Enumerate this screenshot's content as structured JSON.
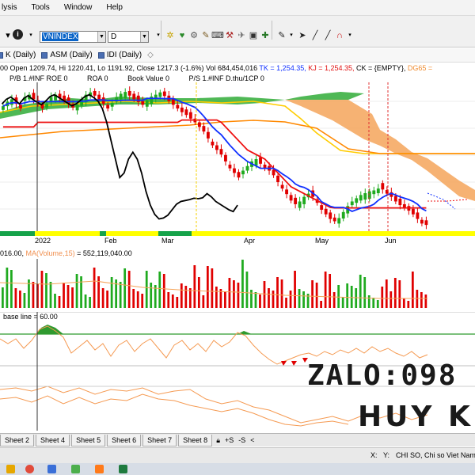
{
  "menu": {
    "items": [
      "lysis",
      "Tools",
      "Window",
      "Help"
    ]
  },
  "toolbar": {
    "symbol_value": "VNINDEX",
    "period_value": "D",
    "icons": [
      "dropdown-arrow-icon",
      "info-icon",
      "chart-tool-icons",
      "color-picker-icon",
      "line-draw-icon",
      "magnet-icon"
    ]
  },
  "chart_tabs": [
    {
      "label": "K (Daily)"
    },
    {
      "label": "ASM (Daily)"
    },
    {
      "label": "IDI (Daily)"
    }
  ],
  "quote": {
    "prefix": "00 Open 1209.74, Hi 1220.41, Lo 1191.92, Close 1217.3 (-1.6%) Vol 684,454,016",
    "tk": "TK = 1,254.35,",
    "kj": "KJ = 1,254.35,",
    "ck": "CK = {EMPTY},",
    "dg": "DG65 ="
  },
  "ratios": [
    "P/B 1.#INF ROE 0",
    "ROA 0",
    "Book Value 0",
    "P/S 1.#INF D.thu/1CP 0"
  ],
  "months": [
    "2022",
    "Feb",
    "Mar",
    "Apr",
    "May",
    "Jun"
  ],
  "volume_legend": {
    "prefix": "016.00,",
    "ma": "MA(Volume,15)",
    "suffix": "= 552,119,040.00"
  },
  "indicator_legend": "base line = 60.00",
  "watermark": {
    "line1": "ZALO:098",
    "line2": "HUY KI"
  },
  "sheets": [
    "Sheet 2",
    "Sheet 4",
    "Sheet 5",
    "Sheet 6",
    "Sheet 7",
    "Sheet 8"
  ],
  "sheet_controls": [
    "+S",
    "-S"
  ],
  "status": {
    "x": "X:",
    "y": "Y:",
    "title": "CHI SO, Chi so Viet Nam"
  },
  "colors": {
    "candle_up": "#1faa1f",
    "candle_down": "#e00000",
    "tenkan": "#1030ff",
    "kijun": "#ee1010",
    "cloud_orange": "#f5a45a",
    "cloud_green": "#3cb043",
    "lagging": "#000000",
    "senkou_a": "#ffcc00",
    "senkou_b": "#ff8800",
    "base_line": "#2f9a2f",
    "oscillator": "#f59a52"
  },
  "chart_data": {
    "type": "line",
    "price_pane": {
      "close": [
        1475,
        1485,
        1490,
        1480,
        1470,
        1495,
        1500,
        1490,
        1480,
        1470,
        1480,
        1495,
        1500,
        1492,
        1486,
        1480,
        1472,
        1478,
        1490,
        1500,
        1505,
        1498,
        1488,
        1480,
        1470,
        1482,
        1495,
        1502,
        1506,
        1498,
        1490,
        1484,
        1478,
        1488,
        1496,
        1500,
        1505,
        1497,
        1486,
        1478,
        1470,
        1462,
        1456,
        1448,
        1440,
        1430,
        1420,
        1405,
        1390,
        1380,
        1370,
        1355,
        1340,
        1330,
        1320,
        1335,
        1345,
        1355,
        1360,
        1350,
        1340,
        1335,
        1325,
        1310,
        1296,
        1284,
        1270,
        1262,
        1268,
        1278,
        1285,
        1278,
        1265,
        1250,
        1240,
        1230,
        1225,
        1232,
        1245,
        1258,
        1268,
        1275,
        1282,
        1286,
        1290,
        1292,
        1296,
        1294,
        1285,
        1278,
        1268,
        1260,
        1254,
        1248,
        1240,
        1230,
        1220,
        1217
      ],
      "kijun": [
        1430,
        1430,
        1430,
        1430,
        1430,
        1430,
        1430,
        1430,
        1440,
        1440,
        1440,
        1440,
        1440,
        1440,
        1440,
        1440,
        1440,
        1440,
        1440,
        1440,
        1440,
        1440,
        1440,
        1440,
        1440,
        1440,
        1440,
        1440,
        1440,
        1440,
        1440,
        1440,
        1440,
        1440,
        1440,
        1440,
        1440,
        1440,
        1440,
        1440,
        1440,
        1445,
        1445,
        1445,
        1445,
        1445,
        1445,
        1445,
        1445,
        1445,
        1440,
        1430,
        1420,
        1410,
        1400,
        1390,
        1380,
        1375,
        1370,
        1365,
        1360,
        1350,
        1340,
        1330,
        1320,
        1310,
        1300,
        1295,
        1290,
        1285,
        1280,
        1275,
        1270,
        1265,
        1260,
        1255,
        1254,
        1254,
        1254,
        1254,
        1254,
        1254,
        1254,
        1254,
        1254,
        1254,
        1254,
        1254,
        1254,
        1254,
        1254,
        1254,
        1254,
        1254,
        1254,
        1254,
        1254,
        1254
      ],
      "lagging": [
        1480,
        1490,
        1495,
        1488,
        1480,
        1492,
        1498,
        1490,
        1484,
        1478,
        1486,
        1496,
        1500,
        1494,
        1488,
        1482,
        1476,
        1480,
        1488,
        1496,
        1500,
        1494,
        1486,
        1470,
        1440,
        1400,
        1360,
        1320,
        1330,
        1360,
        1375,
        1360,
        1330,
        1290,
        1260,
        1240,
        1230,
        1232,
        1238,
        1250,
        1262,
        1268,
        1270,
        1272,
        1275,
        1274,
        1276,
        1285,
        1278,
        1268,
        1262,
        1256,
        1250,
        1246,
        1260
      ],
      "ylim": [
        1200,
        1520
      ]
    }
  }
}
